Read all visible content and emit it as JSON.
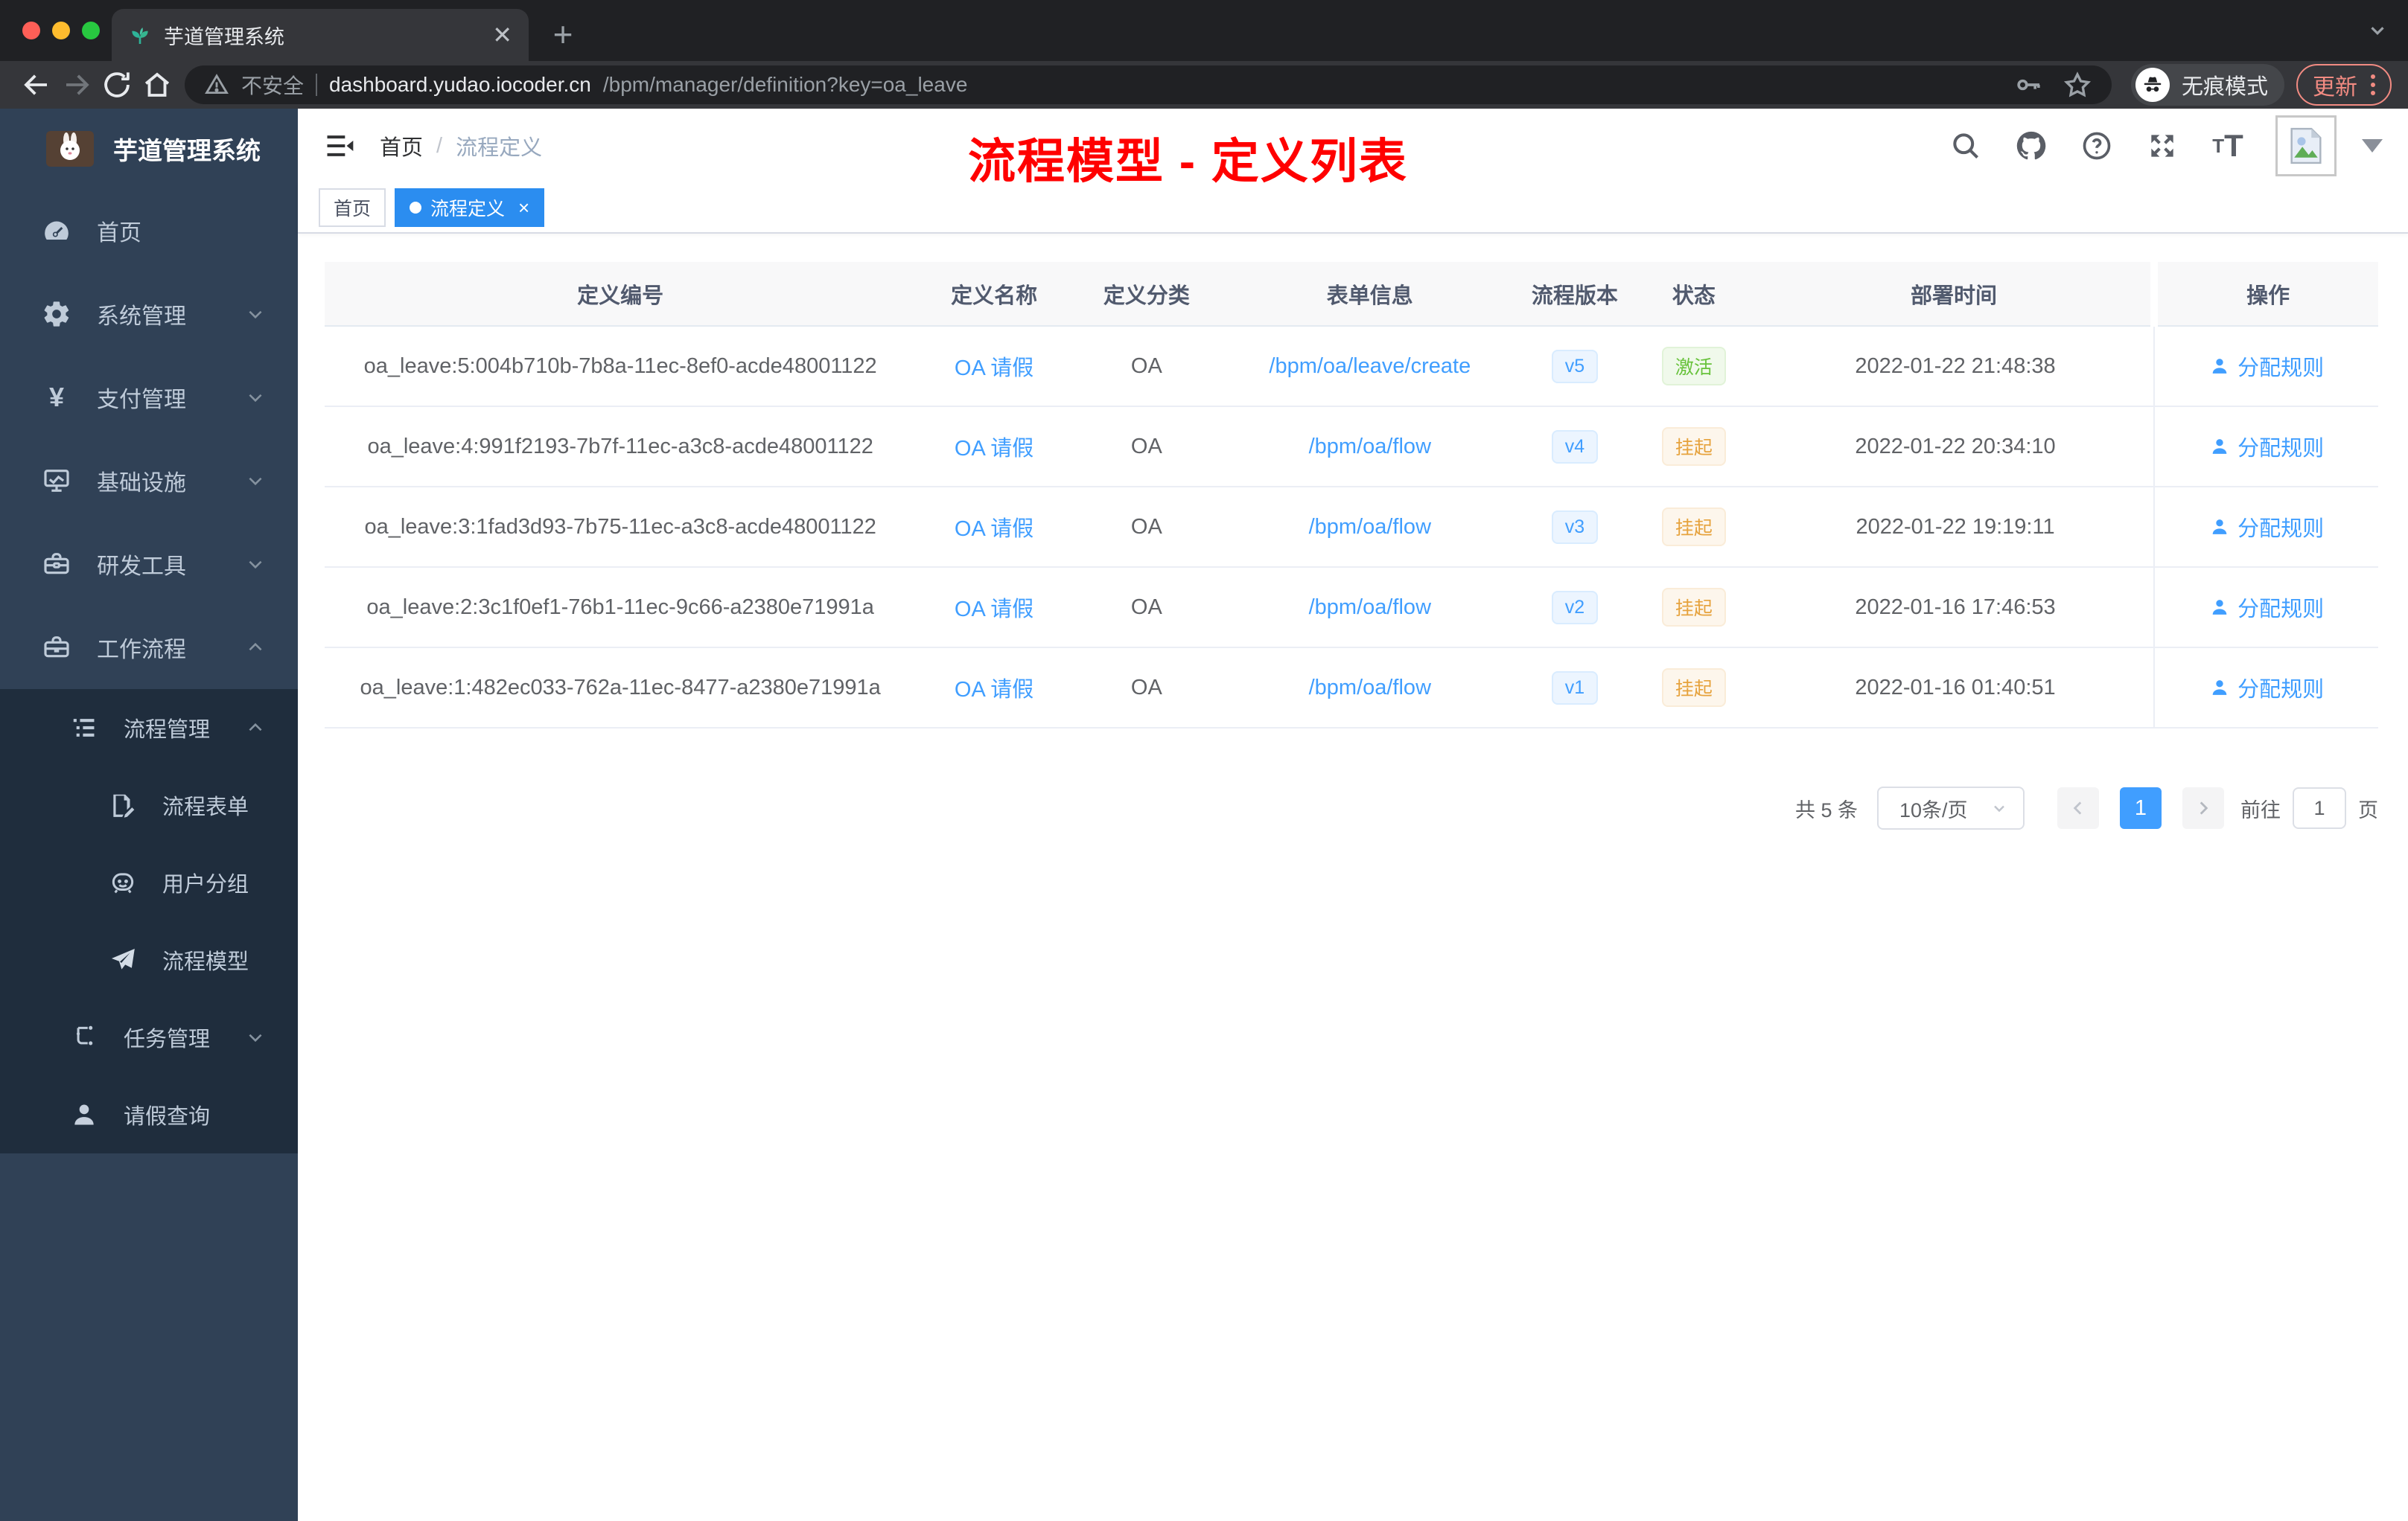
{
  "colors": {
    "accent": "#409EFF",
    "success": "#67c23a",
    "warning": "#e6a23c",
    "annotation": "#ff0000",
    "sidebar_bg": "#304156",
    "submenu_bg": "#1f2d3d"
  },
  "browser": {
    "tab_title": "芋道管理系统",
    "security": "不安全",
    "url_host": "dashboard.yudao.iocoder.cn",
    "url_path": "/bpm/manager/definition?key=oa_leave",
    "incognito": "无痕模式",
    "update": "更新"
  },
  "sidebar": {
    "logo_title": "芋道管理系统",
    "items": [
      {
        "label": "首页"
      },
      {
        "label": "系统管理"
      },
      {
        "label": "支付管理"
      },
      {
        "label": "基础设施"
      },
      {
        "label": "研发工具"
      },
      {
        "label": "工作流程"
      },
      {
        "label": "流程管理"
      },
      {
        "label": "流程表单"
      },
      {
        "label": "用户分组"
      },
      {
        "label": "流程模型"
      },
      {
        "label": "任务管理"
      },
      {
        "label": "请假查询"
      }
    ]
  },
  "navbar": {
    "breadcrumb_home": "首页",
    "breadcrumb_sep": "/",
    "breadcrumb_current": "流程定义",
    "annotation": "流程模型 - 定义列表"
  },
  "tagbar": {
    "tags": [
      {
        "label": "首页"
      },
      {
        "label": "流程定义"
      }
    ]
  },
  "table": {
    "columns": [
      "定义编号",
      "定义名称",
      "定义分类",
      "表单信息",
      "流程版本",
      "状态",
      "部署时间",
      "操作"
    ],
    "rows": [
      {
        "id": "oa_leave:5:004b710b-7b8a-11ec-8ef0-acde48001122",
        "name": "OA 请假",
        "category": "OA",
        "form": "/bpm/oa/leave/create",
        "version": "v5",
        "status": "激活",
        "time": "2022-01-22 21:48:38",
        "action": "分配规则"
      },
      {
        "id": "oa_leave:4:991f2193-7b7f-11ec-a3c8-acde48001122",
        "name": "OA 请假",
        "category": "OA",
        "form": "/bpm/oa/flow",
        "version": "v4",
        "status": "挂起",
        "time": "2022-01-22 20:34:10",
        "action": "分配规则"
      },
      {
        "id": "oa_leave:3:1fad3d93-7b75-11ec-a3c8-acde48001122",
        "name": "OA 请假",
        "category": "OA",
        "form": "/bpm/oa/flow",
        "version": "v3",
        "status": "挂起",
        "time": "2022-01-22 19:19:11",
        "action": "分配规则"
      },
      {
        "id": "oa_leave:2:3c1f0ef1-76b1-11ec-9c66-a2380e71991a",
        "name": "OA 请假",
        "category": "OA",
        "form": "/bpm/oa/flow",
        "version": "v2",
        "status": "挂起",
        "time": "2022-01-16 17:46:53",
        "action": "分配规则"
      },
      {
        "id": "oa_leave:1:482ec033-762a-11ec-8477-a2380e71991a",
        "name": "OA 请假",
        "category": "OA",
        "form": "/bpm/oa/flow",
        "version": "v1",
        "status": "挂起",
        "time": "2022-01-16 01:40:51",
        "action": "分配规则"
      }
    ]
  },
  "pagination": {
    "total": "共 5 条",
    "page_size": "10条/页",
    "current_page": "1",
    "goto_label": "前往",
    "goto_value": "1",
    "page_unit": "页"
  }
}
